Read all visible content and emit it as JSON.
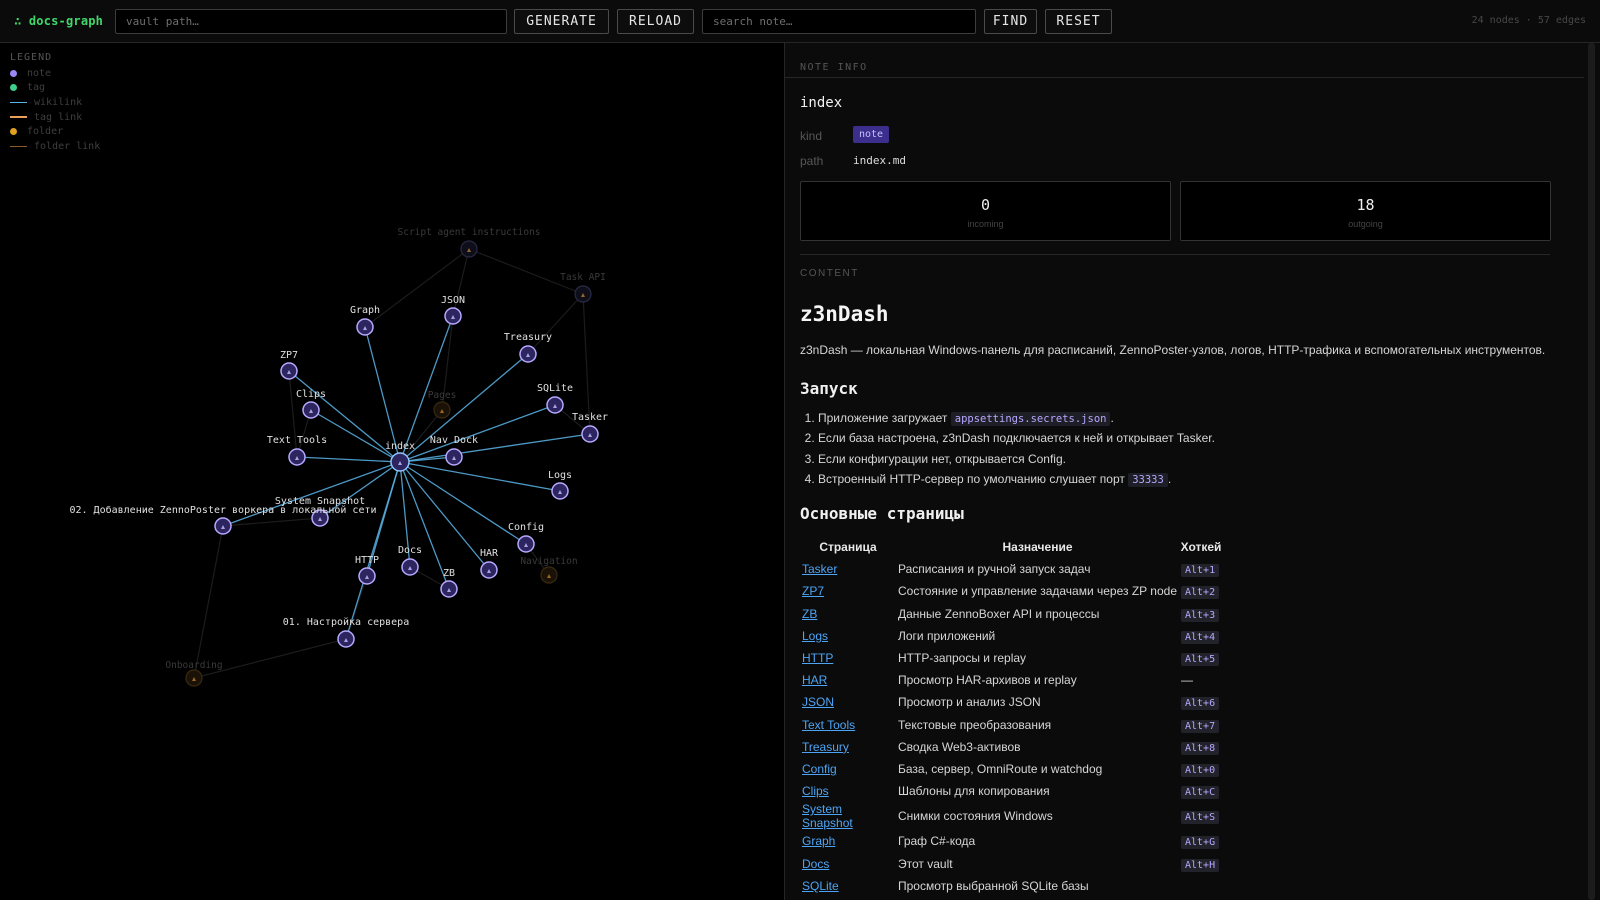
{
  "toolbar": {
    "brand": "∴ docs-graph",
    "vault_placeholder": "vault path…",
    "generate_label": "GENERATE",
    "reload_label": "RELOAD",
    "search_placeholder": "search note…",
    "find_label": "FIND",
    "reset_label": "RESET",
    "stats": "24 nodes · 57 edges"
  },
  "legend": {
    "title": "LEGEND",
    "items": [
      {
        "label": "note",
        "kind": "dot",
        "color": "#9b87f5"
      },
      {
        "label": "tag",
        "kind": "dot",
        "color": "#3ecf8e"
      },
      {
        "label": "wikilink",
        "kind": "line",
        "color": "#5ab4e8"
      },
      {
        "label": "tag link",
        "kind": "line",
        "color": "#e8a05a"
      },
      {
        "label": "folder",
        "kind": "dot",
        "color": "#e0a020"
      },
      {
        "label": "folder link",
        "kind": "line",
        "color": "#8a5a2a"
      }
    ]
  },
  "graph": {
    "center": "index",
    "nodes": [
      {
        "label": "index",
        "active": true
      },
      {
        "label": "Graph",
        "active": true
      },
      {
        "label": "JSON",
        "active": true
      },
      {
        "label": "ZP7",
        "active": true
      },
      {
        "label": "Clips",
        "active": true
      },
      {
        "label": "Treasury",
        "active": true
      },
      {
        "label": "SQLite",
        "active": true
      },
      {
        "label": "Tasker",
        "active": true
      },
      {
        "label": "Text Tools",
        "active": true
      },
      {
        "label": "Nav Dock",
        "active": true
      },
      {
        "label": "Logs",
        "active": true
      },
      {
        "label": "System Snapshot",
        "active": true
      },
      {
        "label": "02. Добавление ZennoPoster воркера в локальной сети",
        "active": true
      },
      {
        "label": "Config",
        "active": true
      },
      {
        "label": "HTTP",
        "active": true
      },
      {
        "label": "Docs",
        "active": true
      },
      {
        "label": "HAR",
        "active": true
      },
      {
        "label": "ZB",
        "active": true
      },
      {
        "label": "01. Настройка сервера",
        "active": true
      },
      {
        "label": "Script agent instructions",
        "active": false
      },
      {
        "label": "Task API",
        "active": false
      },
      {
        "label": "Pages",
        "active": false
      },
      {
        "label": "Navigation",
        "active": false
      },
      {
        "label": "Onboarding",
        "active": false
      }
    ]
  },
  "note_info": {
    "section_title": "NOTE INFO",
    "name": "index",
    "kind_label": "kind",
    "kind_value": "note",
    "path_label": "path",
    "path_value": "index.md",
    "incoming_count": "0",
    "incoming_label": "incoming",
    "outgoing_count": "18",
    "outgoing_label": "outgoing"
  },
  "content": {
    "section_title": "CONTENT",
    "title": "z3nDash",
    "intro": "z3nDash — локальная Windows-панель для расписаний, ZennoPoster-узлов, логов, HTTP-трафика и вспомогательных инструментов.",
    "launch_heading": "Запуск",
    "steps": [
      {
        "pre": "Приложение загружает ",
        "code": "appsettings.secrets.json",
        "post": "."
      },
      {
        "pre": "Если база настроена, z3nDash подключается к ней и открывает Tasker.",
        "code": "",
        "post": ""
      },
      {
        "pre": "Если конфигурации нет, открывается Config.",
        "code": "",
        "post": ""
      },
      {
        "pre": "Встроенный HTTP-сервер по умолчанию слушает порт ",
        "code": "33333",
        "post": "."
      }
    ],
    "pages_heading": "Основные страницы",
    "table_headers": [
      "Страница",
      "Назначение",
      "Хоткей"
    ],
    "rows": [
      {
        "page": "Tasker",
        "purpose": "Расписания и ручной запуск задач",
        "hotkey": "Alt+1"
      },
      {
        "page": "ZP7",
        "purpose": "Состояние и управление задачами через ZP node",
        "hotkey": "Alt+2"
      },
      {
        "page": "ZB",
        "purpose": "Данные ZennoBoxer API и процессы",
        "hotkey": "Alt+3"
      },
      {
        "page": "Logs",
        "purpose": "Логи приложений",
        "hotkey": "Alt+4"
      },
      {
        "page": "HTTP",
        "purpose": "HTTP-запросы и replay",
        "hotkey": "Alt+5"
      },
      {
        "page": "HAR",
        "purpose": "Просмотр HAR-архивов и replay",
        "hotkey": "—"
      },
      {
        "page": "JSON",
        "purpose": "Просмотр и анализ JSON",
        "hotkey": "Alt+6"
      },
      {
        "page": "Text Tools",
        "purpose": "Текстовые преобразования",
        "hotkey": "Alt+7"
      },
      {
        "page": "Treasury",
        "purpose": "Сводка Web3-активов",
        "hotkey": "Alt+8"
      },
      {
        "page": "Config",
        "purpose": "База, сервер, OmniRoute и watchdog",
        "hotkey": "Alt+0"
      },
      {
        "page": "Clips",
        "purpose": "Шаблоны для копирования",
        "hotkey": "Alt+C"
      },
      {
        "page": "System Snapshot",
        "purpose": "Снимки состояния Windows",
        "hotkey": "Alt+S"
      },
      {
        "page": "Graph",
        "purpose": "Граф C#-кода",
        "hotkey": "Alt+G"
      },
      {
        "page": "Docs",
        "purpose": "Этот vault",
        "hotkey": "Alt+H"
      },
      {
        "page": "SQLite",
        "purpose": "Просмотр выбранной SQLite базы",
        "hotkey": ""
      }
    ]
  },
  "colors": {
    "note": "#9b87f5",
    "wikilink": "#5ab4e8",
    "brand": "#41d86b",
    "link": "#4ea4f4",
    "badge": "#3b2e8c"
  }
}
